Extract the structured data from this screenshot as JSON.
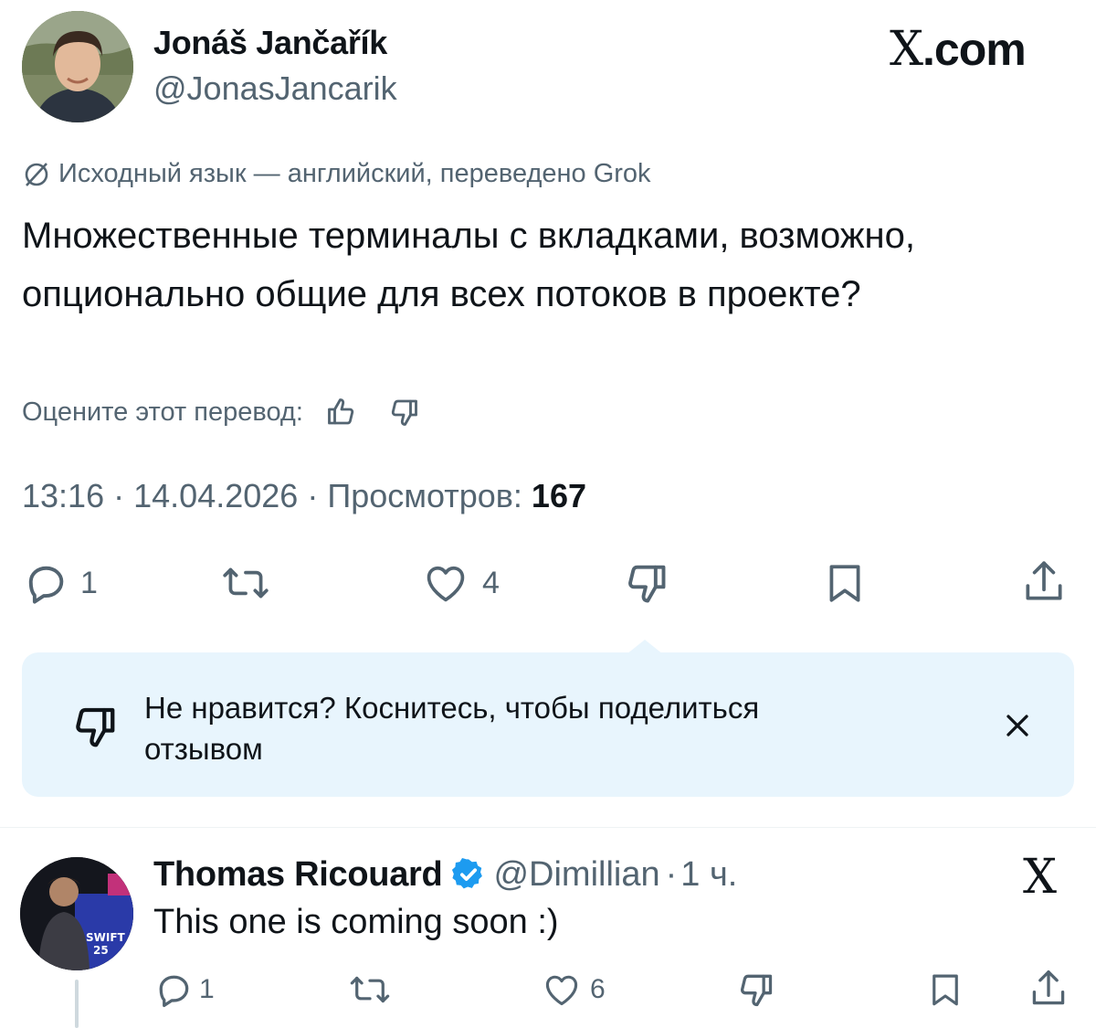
{
  "author": {
    "name": "Jonáš Jančařík",
    "handle": "@JonasJancarik"
  },
  "brand": {
    "x": "X",
    "domain": ".com"
  },
  "translation": {
    "notice": "Исходный язык — английский, переведено Grok",
    "icon": "slash-circle-icon"
  },
  "tweet": {
    "text": "Множественные терминалы с вкладками, возможно, опционально общие для всех потоков в проекте?",
    "rate_label": "Оцените этот перевод:",
    "time": "13:16",
    "date": "14.04.2026",
    "views_label": "Просмотров:",
    "views": "167",
    "separator": "·"
  },
  "actions": {
    "replies": "1",
    "likes": "4"
  },
  "callout": {
    "text": "Не нравится? Коснитесь, чтобы поделиться отзывом"
  },
  "reply": {
    "name": "Thomas Ricouard",
    "handle": "@Dimillian",
    "time": "1 ч.",
    "separator": "·",
    "text": "This one is coming soon :)",
    "replies": "1",
    "likes": "6",
    "avatar_text": "SWIFT 25"
  },
  "colors": {
    "text": "#0f1419",
    "muted": "#536471",
    "callout_bg": "#e8f5fd",
    "verified": "#1d9bf0"
  }
}
